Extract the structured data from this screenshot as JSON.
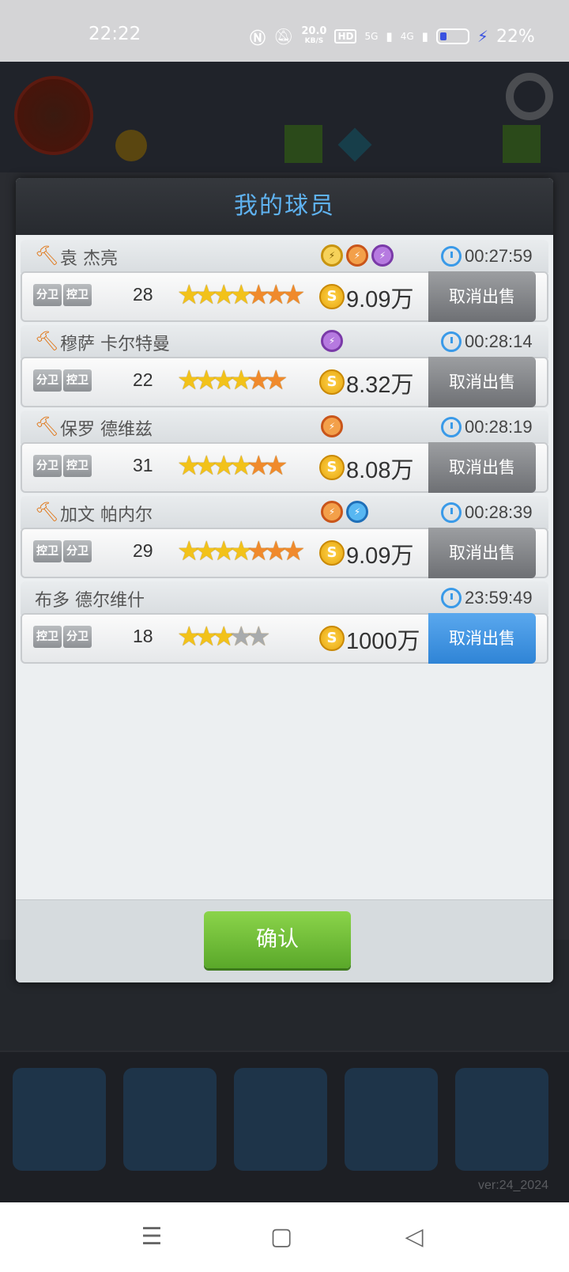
{
  "status_bar": {
    "time": "22:22",
    "net_speed_value": "20.0",
    "net_speed_unit": "KB/S",
    "hd_label": "HD",
    "signal1_label": "5G",
    "signal2_label": "4G",
    "battery_percent": "22%"
  },
  "background": {
    "version": "ver:24_2024"
  },
  "modal": {
    "title": "我的球员",
    "confirm_label": "确认",
    "players": [
      {
        "name": "袁 杰亮",
        "has_auction_icon": true,
        "timer": "00:27:59",
        "positions": [
          "分卫",
          "控卫"
        ],
        "age": "28",
        "stars": {
          "gold": 4,
          "orange": 3,
          "gray": 0
        },
        "price": "9.09万",
        "cancel_label": "取消出售",
        "badges": [
          "gold",
          "orange",
          "purple"
        ]
      },
      {
        "name": "穆萨 卡尔特曼",
        "has_auction_icon": true,
        "timer": "00:28:14",
        "positions": [
          "分卫",
          "控卫"
        ],
        "age": "22",
        "stars": {
          "gold": 4,
          "orange": 2,
          "gray": 0
        },
        "price": "8.32万",
        "cancel_label": "取消出售",
        "badges": [
          "purple"
        ]
      },
      {
        "name": "保罗 德维兹",
        "has_auction_icon": true,
        "timer": "00:28:19",
        "positions": [
          "分卫",
          "控卫"
        ],
        "age": "31",
        "stars": {
          "gold": 4,
          "orange": 2,
          "gray": 0
        },
        "price": "8.08万",
        "cancel_label": "取消出售",
        "badges": [
          "orange"
        ]
      },
      {
        "name": "加文 帕内尔",
        "has_auction_icon": true,
        "timer": "00:28:39",
        "positions": [
          "控卫",
          "分卫"
        ],
        "age": "29",
        "stars": {
          "gold": 4,
          "orange": 3,
          "gray": 0
        },
        "price": "9.09万",
        "cancel_label": "取消出售",
        "badges": [
          "orange",
          "blue"
        ]
      },
      {
        "name": "布多 德尔维什",
        "has_auction_icon": false,
        "timer": "23:59:49",
        "positions": [
          "控卫",
          "分卫"
        ],
        "age": "18",
        "stars": {
          "gold": 3,
          "orange": 0,
          "gray": 2
        },
        "price": "1000万",
        "cancel_label": "取消出售",
        "badges": []
      }
    ]
  },
  "colors": {
    "title": "#5fb2f0",
    "confirm": "#6bbf35",
    "cancel_active": "#3f93e0",
    "cancel_inactive": "#84878b"
  }
}
